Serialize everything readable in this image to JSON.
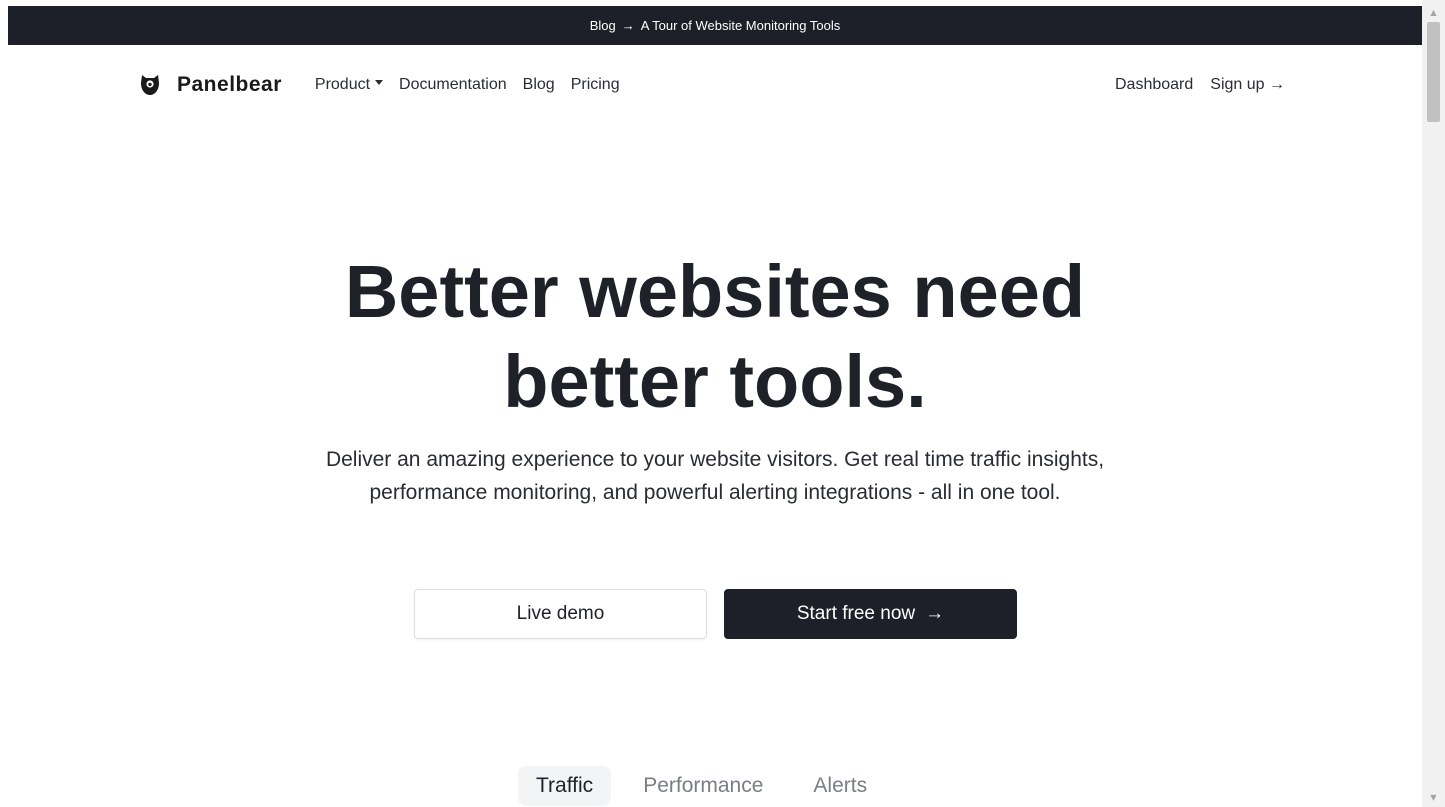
{
  "announcement": {
    "prefix": "Blog",
    "separator": "→",
    "text": "A Tour of Website Monitoring Tools"
  },
  "nav": {
    "brand": "Panelbear",
    "links": {
      "product": "Product",
      "documentation": "Documentation",
      "blog": "Blog",
      "pricing": "Pricing"
    },
    "right": {
      "dashboard": "Dashboard",
      "signup": "Sign up →"
    }
  },
  "hero": {
    "title_line1": "Better websites need",
    "title_line2": "better tools.",
    "subtitle": "Deliver an amazing experience to your website visitors. Get real time traffic insights, performance monitoring, and powerful alerting integrations - all in one tool.",
    "demo_button": "Live demo",
    "start_button": "Start free now",
    "start_arrow": "→"
  },
  "tabs": {
    "traffic": "Traffic",
    "performance": "Performance",
    "alerts": "Alerts",
    "active": "Traffic"
  },
  "colors": {
    "dark": "#1e2029",
    "text": "#1f2129",
    "muted": "#7b7d85",
    "tab_active_bg": "#f3f4f6"
  },
  "icons": {
    "brand_logo": "bear-head-icon",
    "product_caret": "caret-down-icon"
  }
}
